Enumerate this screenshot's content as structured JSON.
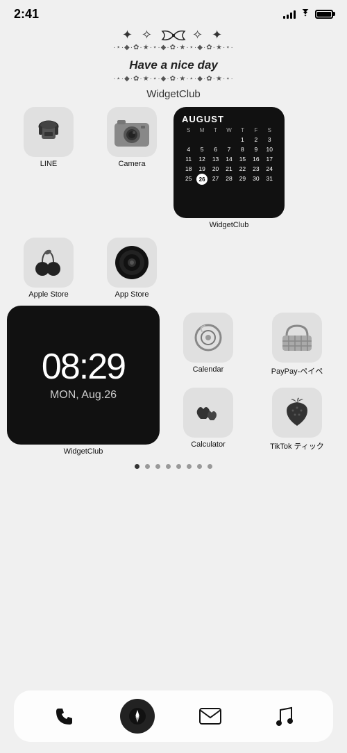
{
  "statusBar": {
    "time": "2:41",
    "battery": "full"
  },
  "decoration": {
    "bow": "✦ ✧ 𝓑 ✧ ✦",
    "bowSymbol": "⋆ ✦ ✧ ❋ ✧ ✦ ⋆",
    "starsTop": "·✦·⋆·❋·✦·✧·✦·❋·⋆·✦·",
    "tagline": "Have a nice day",
    "starsBottom": "·✦·⋆·❋·✦·✧·✦·❋·⋆·✦·",
    "widgetLabel": "WidgetClub"
  },
  "apps": [
    {
      "name": "LINE",
      "icon": "telephone"
    },
    {
      "name": "Camera",
      "icon": "camera"
    },
    {
      "name": "Apple Store",
      "icon": "cherry"
    },
    {
      "name": "App Store",
      "icon": "vinyl"
    }
  ],
  "calendarWidget": {
    "month": "AUGUST",
    "weekdays": [
      "S",
      "M",
      "T",
      "W",
      "T",
      "F",
      "S"
    ],
    "days": [
      {
        "d": "",
        "empty": true
      },
      {
        "d": "",
        "empty": true
      },
      {
        "d": "",
        "empty": true
      },
      {
        "d": "",
        "empty": true
      },
      {
        "d": "1"
      },
      {
        "d": "2"
      },
      {
        "d": "3"
      },
      {
        "d": "4"
      },
      {
        "d": "5"
      },
      {
        "d": "6"
      },
      {
        "d": "7"
      },
      {
        "d": "8"
      },
      {
        "d": "9"
      },
      {
        "d": "10"
      },
      {
        "d": "11"
      },
      {
        "d": "12"
      },
      {
        "d": "13"
      },
      {
        "d": "14"
      },
      {
        "d": "15"
      },
      {
        "d": "16"
      },
      {
        "d": "17"
      },
      {
        "d": "18"
      },
      {
        "d": "19"
      },
      {
        "d": "20"
      },
      {
        "d": "21"
      },
      {
        "d": "22"
      },
      {
        "d": "23"
      },
      {
        "d": "24"
      },
      {
        "d": "25"
      },
      {
        "d": "26",
        "today": true
      },
      {
        "d": "27"
      },
      {
        "d": "28"
      },
      {
        "d": "29"
      },
      {
        "d": "30"
      },
      {
        "d": "31"
      }
    ],
    "widgetLabel": "WidgetClub"
  },
  "clockWidget": {
    "time": "08:29",
    "date": "MON, Aug.26",
    "widgetLabel": "WidgetClub"
  },
  "rightApps": [
    {
      "name": "Calendar",
      "icon": "ring"
    },
    {
      "name": "PayPay-ペイペ",
      "icon": "basket"
    },
    {
      "name": "Calculator",
      "icon": "hearts"
    },
    {
      "name": "TikTok ティック",
      "icon": "strawberry"
    }
  ],
  "pageDots": [
    true,
    false,
    false,
    false,
    false,
    false,
    false,
    false
  ],
  "dock": {
    "items": [
      {
        "name": "Phone",
        "icon": "phone"
      },
      {
        "name": "Safari",
        "icon": "compass"
      },
      {
        "name": "Mail",
        "icon": "mail"
      },
      {
        "name": "Music",
        "icon": "music"
      }
    ]
  }
}
